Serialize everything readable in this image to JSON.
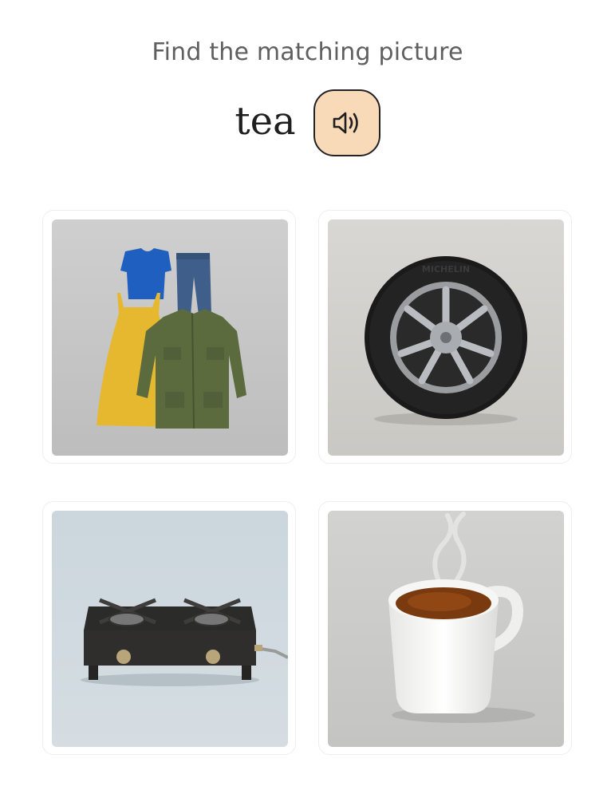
{
  "prompt": "Find the matching picture",
  "word": "tea",
  "audio_button": {
    "icon": "speaker-icon",
    "background": "#f8d9b8"
  },
  "options": [
    {
      "icon": "clothes-image"
    },
    {
      "icon": "tire-image"
    },
    {
      "icon": "stove-image"
    },
    {
      "icon": "tea-cup-image"
    }
  ],
  "tire_brand_text": "MICHELIN"
}
